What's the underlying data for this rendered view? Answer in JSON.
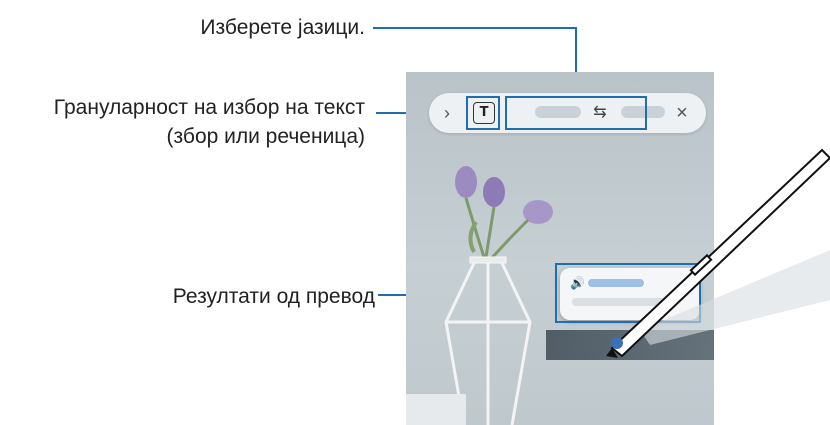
{
  "callouts": {
    "languages": "Изберете јазици.",
    "granularity_line1": "Грануларност на избор на текст",
    "granularity_line2": "(збор или реченица)",
    "results": "Резултати од превод"
  },
  "toolbar": {
    "chevron_glyph": "›",
    "text_mode_glyph": "T",
    "swap_glyph": "⇆",
    "close_glyph": "×"
  },
  "result_card": {
    "speaker_glyph": "🔊"
  },
  "colors": {
    "leader": "#1f6fb0",
    "phone_background": "#c0c9ce",
    "toolbar": "#eef1f3"
  }
}
